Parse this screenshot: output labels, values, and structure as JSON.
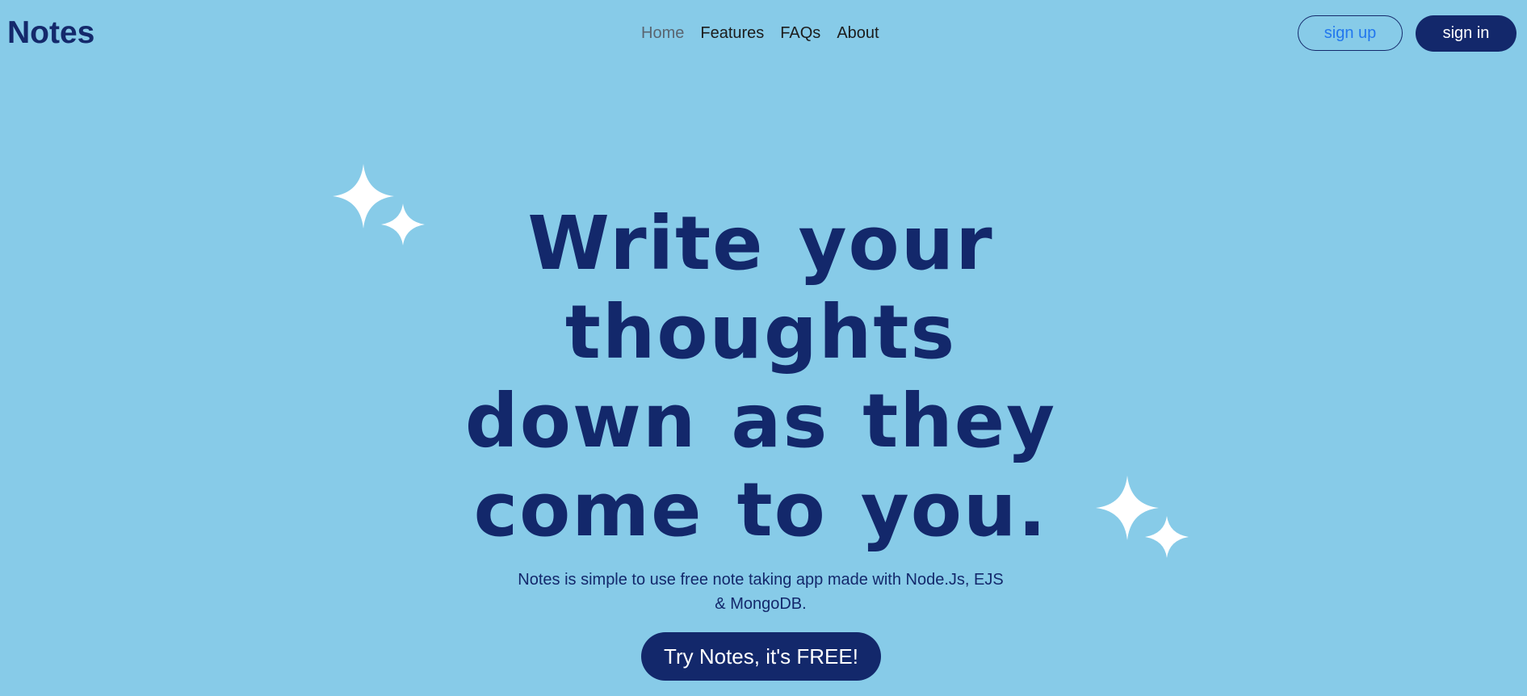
{
  "header": {
    "brand": "Notes",
    "nav": [
      "Home",
      "Features",
      "FAQs",
      "About"
    ],
    "signup_label": "sign up",
    "signin_label": "sign in"
  },
  "hero": {
    "title": "Write your thoughts down as they come to you.",
    "subtitle": "Notes is simple to use free note taking app made with Node.Js, EJS & MongoDB.",
    "cta_label": "Try Notes, it's FREE!"
  },
  "icons": {
    "sparkle_left": "sparkles-icon",
    "sparkle_right": "sparkles-icon"
  },
  "colors": {
    "background": "#87cbe8",
    "primary": "#13286b",
    "link_blue": "#2277ee",
    "sparkle": "#ffffff"
  }
}
